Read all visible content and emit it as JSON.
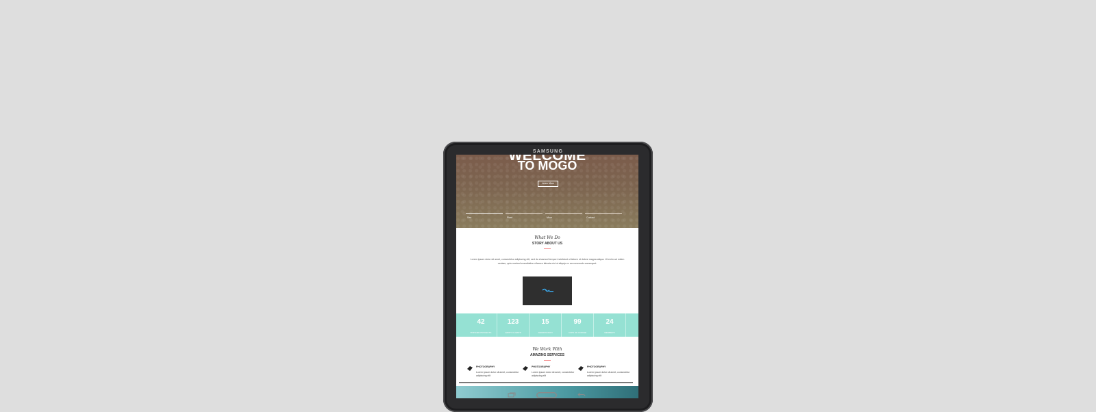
{
  "device": {
    "brand": "SAMSUNG"
  },
  "hero": {
    "cut_title": "WELCOME",
    "title": "TO MOGO",
    "button_label": "Learn More",
    "nav": [
      "Sea",
      "Plant",
      "Moor",
      "Contact"
    ]
  },
  "about": {
    "script_title": "What We Do",
    "subtitle": "STORY ABOUT US",
    "text": "Lorem ipsum dolor sit amet, consectetur adipiscing elit, sed do eiusmod tempor incididunt ut labore et dolore magna aliqua. Ut enim ad minim veniam, quis nostrud exercitation ullamco laboris nisi ut aliquip ex ea commodo consequat."
  },
  "stats": [
    {
      "value": "42",
      "label": "FINISHED PROJECTS"
    },
    {
      "value": "123",
      "label": "HAPPY CLIENTS"
    },
    {
      "value": "15",
      "label": "AWARDS WON"
    },
    {
      "value": "99",
      "label": "CUPS OF COFFEE"
    },
    {
      "value": "24",
      "label": "MEMBERS"
    }
  ],
  "services": {
    "script_title": "We Work With",
    "subtitle": "AMAZING SERVICES",
    "items": [
      {
        "title": "PHOTOGRAPHY",
        "text": "Lorem ipsum dolor sit amet, consectetur adipiscing elit"
      },
      {
        "title": "PHOTOGRAPHY",
        "text": "Lorem ipsum dolor sit amet, consectetur adipiscing elit"
      },
      {
        "title": "PHOTOGRAPHY",
        "text": "Lorem ipsum dolor sit amet, consectetur adipiscing elit"
      }
    ]
  },
  "colors": {
    "accent": "#95e1d3",
    "divider": "#f38181",
    "device": "#2b2b2d"
  }
}
